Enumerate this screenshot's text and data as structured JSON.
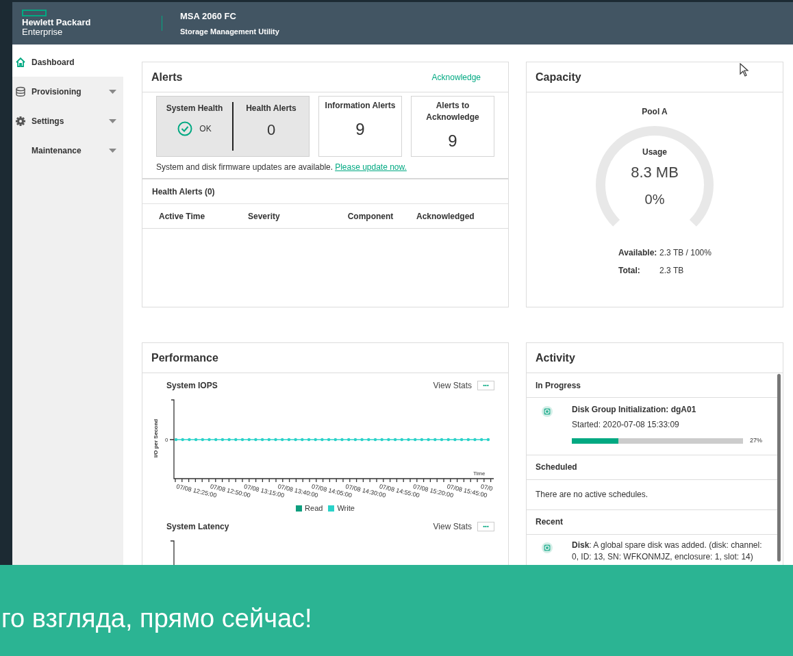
{
  "header": {
    "brand_line1": "Hewlett Packard",
    "brand_line2": "Enterprise",
    "product": "MSA 2060 FC",
    "subtitle": "Storage Management Utility"
  },
  "sidebar": {
    "items": [
      {
        "label": "Dashboard",
        "kind": "home",
        "selected": true,
        "has_menu": false
      },
      {
        "label": "Provisioning",
        "kind": "storage",
        "selected": false,
        "has_menu": true
      },
      {
        "label": "Settings",
        "kind": "settings",
        "selected": false,
        "has_menu": true
      },
      {
        "label": "Maintenance",
        "kind": "plain",
        "selected": false,
        "has_menu": true
      }
    ]
  },
  "alerts": {
    "title": "Alerts",
    "action": "Acknowledge",
    "health": {
      "label": "System Health",
      "status": "OK",
      "ok": true
    },
    "health_alerts": {
      "label": "Health Alerts",
      "value": "0"
    },
    "tiles": [
      {
        "label": "Information Alerts",
        "value": "9"
      },
      {
        "label": "Alerts to Acknowledge",
        "value": "9"
      }
    ],
    "notice": "System and disk firmware updates are available.",
    "notice_link": "Please update now.",
    "table": {
      "title": "Health Alerts (0)",
      "columns": [
        "Active Time",
        "Severity",
        "Component",
        "Acknowledged"
      ]
    }
  },
  "capacity": {
    "title": "Capacity",
    "pool": "Pool A",
    "usage_label": "Usage",
    "usage_value": "8.3 MB",
    "percent": "0%",
    "available_label": "Available:",
    "available_value": "2.3 TB / 100%",
    "total_label": "Total:",
    "total_value": "2.3 TB"
  },
  "performance": {
    "title": "Performance",
    "charts": [
      {
        "title": "System IOPS",
        "action": "View Stats",
        "more": "•••",
        "ylabel": "I/O per Second",
        "ytick": "0",
        "xlabel": "Time",
        "x_labels": [
          "07/08 12:25:00",
          "07/08 12:50:00",
          "07/08 13:15:00",
          "07/08 13:40:00",
          "07/08 14:05:00",
          "07/08 14:30:00",
          "07/08 14:55:00",
          "07/08 15:20:00",
          "07/08 15:45:00",
          "07/0"
        ],
        "legend": [
          {
            "label": "Read",
            "color": "#0e9e7e"
          },
          {
            "label": "Write",
            "color": "#2ad2c9"
          }
        ]
      },
      {
        "title": "System Latency",
        "action": "View Stats",
        "more": "•••"
      }
    ]
  },
  "activity": {
    "title": "Activity",
    "in_progress": {
      "title": "In Progress",
      "items": [
        {
          "title": "Disk Group Initialization: dgA01",
          "started": "Started: 2020-07-08 15:33:09",
          "level": 0.27,
          "percent": "27%"
        }
      ]
    },
    "scheduled": {
      "title": "Scheduled",
      "empty": "There are no active schedules."
    },
    "recent": {
      "title": "Recent",
      "items": [
        {
          "text": "**Disk**: A global spare disk was added. (disk: channel: 0, ID: 13, SN: WFKONMJZ, enclosure: 1, slot: 14)"
        }
      ]
    }
  },
  "caption": {
    "text": "го взгляда, прямо сейчас!"
  }
}
